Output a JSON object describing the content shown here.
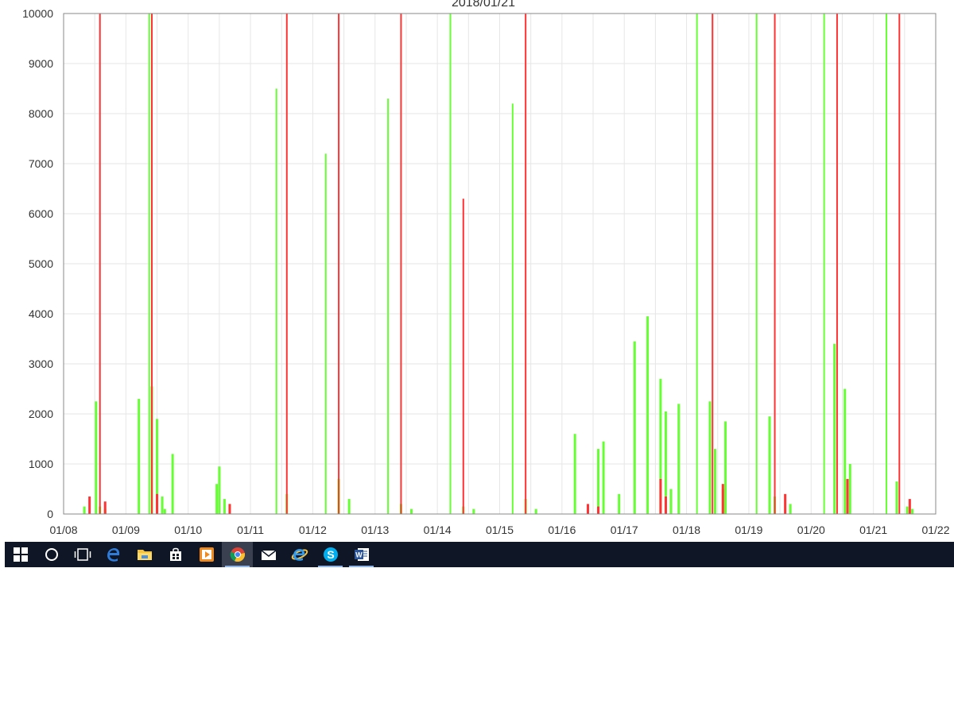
{
  "colors": {
    "green_series": "#66ff33",
    "red_series": "#ff3333",
    "grid": "#e6e6e6",
    "axis": "#888888",
    "taskbar": "#0f1626"
  },
  "taskbar": {
    "icons": [
      {
        "name": "windows-start-icon",
        "icon": "windows-logo",
        "open": false
      },
      {
        "name": "search-cortana-icon",
        "icon": "circle",
        "open": false
      },
      {
        "name": "task-view-icon",
        "icon": "task-view",
        "open": false
      },
      {
        "name": "edge-browser-icon",
        "icon": "edge-e",
        "open": false
      },
      {
        "name": "file-explorer-icon",
        "icon": "folder",
        "open": false
      },
      {
        "name": "store-icon",
        "icon": "shopping-bag",
        "open": false
      },
      {
        "name": "media-player-icon",
        "icon": "play-tile",
        "open": false
      },
      {
        "name": "chrome-browser-icon",
        "icon": "chrome",
        "open": true,
        "active": true
      },
      {
        "name": "mail-icon",
        "icon": "envelope",
        "open": false
      },
      {
        "name": "internet-explorer-icon",
        "icon": "ie-e",
        "open": false
      },
      {
        "name": "skype-icon",
        "icon": "skype-s",
        "open": true
      },
      {
        "name": "word-icon",
        "icon": "word-w",
        "open": true
      }
    ]
  },
  "chart_data": {
    "type": "area",
    "title": "2018/01/21",
    "xlabel": "",
    "ylabel": "",
    "x_ticks": [
      "01/08",
      "01/09",
      "01/10",
      "01/11",
      "01/12",
      "01/13",
      "01/14",
      "01/15",
      "01/16",
      "01/17",
      "01/18",
      "01/19",
      "01/20",
      "01/21",
      "01/22"
    ],
    "y_ticks": [
      "0",
      "1000",
      "2000",
      "3000",
      "4000",
      "5000",
      "6000",
      "7000",
      "8000",
      "9000",
      "10000"
    ],
    "xlim": [
      "01/08",
      "01/22"
    ],
    "ylim": [
      0,
      10000
    ],
    "grid": true,
    "legend": "none",
    "series": [
      {
        "color": "#66ff33",
        "x": [
          "01/08 08:00",
          "01/08 12:30",
          "01/08 14:00",
          "01/08 16:00",
          "01/09 05:00",
          "01/09 09:00",
          "01/09 10:00",
          "01/09 12:00",
          "01/09 14:00",
          "01/09 15:00",
          "01/09 18:00",
          "01/10 11:00",
          "01/10 12:00",
          "01/10 14:00",
          "01/10 16:00",
          "01/11 10:00",
          "01/11 14:00",
          "01/12 05:00",
          "01/12 10:00",
          "01/12 14:00",
          "01/13 05:00",
          "01/13 10:00",
          "01/13 14:00",
          "01/14 05:00",
          "01/14 10:00",
          "01/14 14:00",
          "01/15 05:00",
          "01/15 10:00",
          "01/15 14:00",
          "01/16 05:00",
          "01/16 14:00",
          "01/16 16:00",
          "01/16 22:00",
          "01/17 04:00",
          "01/17 09:00",
          "01/17 14:00",
          "01/17 16:00",
          "01/17 18:00",
          "01/17 21:00",
          "01/18 04:00",
          "01/18 09:00",
          "01/18 11:00",
          "01/18 14:00",
          "01/18 15:00",
          "01/19 03:00",
          "01/19 08:00",
          "01/19 10:00",
          "01/19 16:00",
          "01/20 05:00",
          "01/20 09:00",
          "01/20 13:00",
          "01/20 15:00",
          "01/21 05:00",
          "01/21 09:00",
          "01/21 13:00",
          "01/21 15:00"
        ],
        "values": [
          150,
          2250,
          150,
          100,
          2300,
          10000,
          2550,
          1900,
          350,
          100,
          1200,
          600,
          950,
          300,
          200,
          8500,
          400,
          7200,
          700,
          300,
          8300,
          200,
          100,
          10000,
          150,
          100,
          8200,
          300,
          100,
          1600,
          1300,
          1450,
          400,
          3450,
          3950,
          2700,
          2050,
          500,
          2200,
          10000,
          2250,
          1300,
          500,
          1850,
          10000,
          1950,
          350,
          200,
          10000,
          3400,
          2500,
          1000,
          10000,
          650,
          150,
          100
        ]
      },
      {
        "color": "#ff3333",
        "x": [
          "01/08 10:00",
          "01/08 14:00",
          "01/08 16:00",
          "01/09 10:00",
          "01/09 12:00",
          "01/10 16:00",
          "01/11 14:00",
          "01/12 10:00",
          "01/13 10:00",
          "01/14 10:00",
          "01/15 10:00",
          "01/16 10:00",
          "01/16 14:00",
          "01/17 14:00",
          "01/17 16:00",
          "01/18 10:00",
          "01/18 14:00",
          "01/19 10:00",
          "01/19 14:00",
          "01/20 10:00",
          "01/20 14:00",
          "01/21 10:00",
          "01/21 14:00"
        ],
        "values": [
          350,
          10000,
          250,
          10000,
          400,
          200,
          10000,
          10000,
          10000,
          6300,
          10000,
          200,
          150,
          700,
          350,
          10000,
          600,
          10000,
          400,
          10000,
          700,
          10000,
          300
        ]
      }
    ]
  }
}
